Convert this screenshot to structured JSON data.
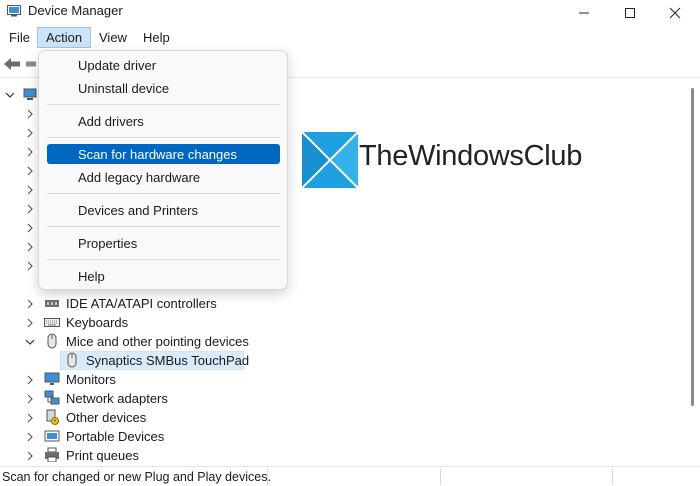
{
  "window": {
    "title": "Device Manager"
  },
  "menubar": {
    "file": "File",
    "action": "Action",
    "view": "View",
    "help": "Help"
  },
  "action_menu": {
    "items": [
      {
        "label": "Update driver"
      },
      {
        "label": "Uninstall device"
      },
      {
        "label": "Add drivers"
      },
      {
        "label": "Scan for hardware changes",
        "highlighted": true
      },
      {
        "label": "Add legacy hardware"
      },
      {
        "label": "Devices and Printers"
      },
      {
        "label": "Properties"
      },
      {
        "label": "Help"
      }
    ]
  },
  "tree": {
    "nodes": [
      {
        "label": "IDE ATA/ATAPI controllers",
        "expanded": false
      },
      {
        "label": "Keyboards",
        "expanded": false
      },
      {
        "label": "Mice and other pointing devices",
        "expanded": true
      },
      {
        "label": "Synaptics SMBus TouchPad",
        "selected": true
      },
      {
        "label": "Monitors",
        "expanded": false
      },
      {
        "label": "Network adapters",
        "expanded": false
      },
      {
        "label": "Other devices",
        "expanded": false
      },
      {
        "label": "Portable Devices",
        "expanded": false
      },
      {
        "label": "Print queues",
        "expanded": false
      }
    ]
  },
  "watermark": {
    "text": "TheWindowsClub"
  },
  "statusbar": {
    "text": "Scan for changed or new Plug and Play devices."
  },
  "colors": {
    "highlight": "#0067c0",
    "menu_active": "#cce4f7",
    "selected_row": "#d9ebf9",
    "watermark_blue": "#1fa0e0"
  }
}
